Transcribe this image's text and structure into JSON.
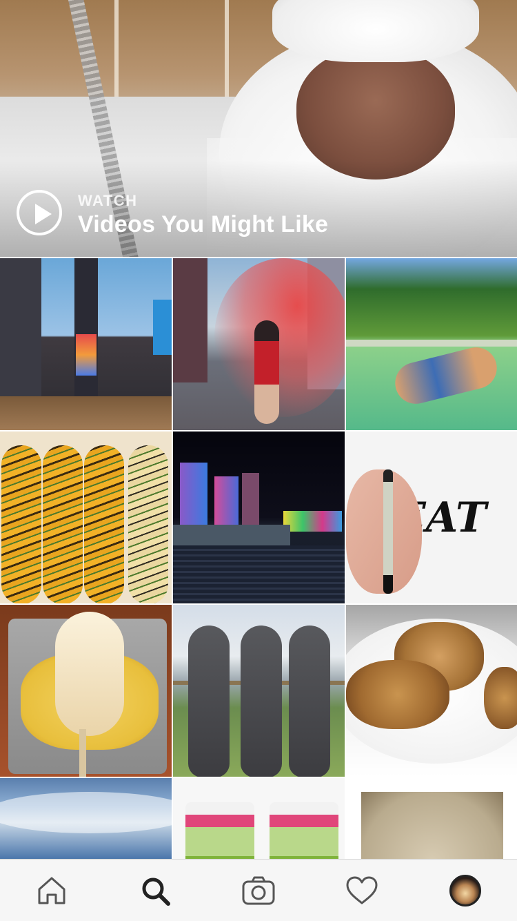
{
  "watch_banner": {
    "kicker": "WATCH",
    "title": "Videos You Might Like",
    "play_icon": "play-circle-icon"
  },
  "explore_grid": {
    "tiles": [
      {
        "name": "times-square-photo"
      },
      {
        "name": "red-smoke-flare-photo"
      },
      {
        "name": "pool-swimmer-photo"
      },
      {
        "name": "grilled-corn-photo"
      },
      {
        "name": "night-city-harbor-photo"
      },
      {
        "name": "eat-lettering-photo"
      },
      {
        "name": "elote-corn-tray-photo"
      },
      {
        "name": "mud-bath-women-photo"
      },
      {
        "name": "oatmeal-cookies-photo"
      },
      {
        "name": "cloudy-sky-photo"
      },
      {
        "name": "kiwi-smoothies-photo"
      },
      {
        "name": "parchment-paper-photo"
      }
    ]
  },
  "tab_bar": {
    "items": [
      {
        "icon": "home-icon",
        "active": false
      },
      {
        "icon": "search-icon",
        "active": true
      },
      {
        "icon": "camera-icon",
        "active": false
      },
      {
        "icon": "heart-icon",
        "active": false
      },
      {
        "icon": "profile-avatar",
        "active": false
      }
    ]
  },
  "colors": {
    "tab_bar_bg": "#f6f6f6",
    "icon_inactive": "#555555",
    "icon_active": "#222222",
    "banner_text": "#ffffff"
  }
}
